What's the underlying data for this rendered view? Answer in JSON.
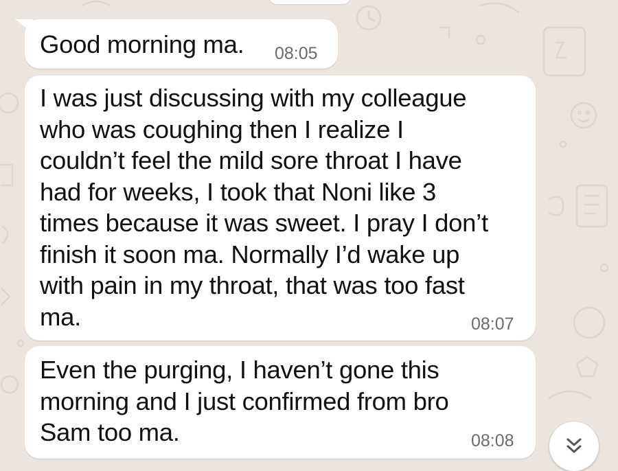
{
  "conversation": {
    "messages": [
      {
        "text": "Good morning ma.",
        "time": "08:05"
      },
      {
        "text": "I was just discussing with my colleague\nwho was coughing then I realize I\ncouldn’t feel the mild sore throat I have\nhad for weeks, I took that Noni like 3\ntimes because it was sweet. I pray I don’t\nfinish it soon ma. Normally I’d wake up\nwith pain in my throat, that was too fast\nma.",
        "time": "08:07"
      },
      {
        "text": "Even the purging, I haven’t gone this\nmorning and I just confirmed from bro\nSam too ma.",
        "time": "08:08"
      }
    ]
  },
  "scroll_button": {
    "icon": "double-chevron-down-icon"
  },
  "colors": {
    "wallpaper": "#ece5dd",
    "bubble": "#ffffff",
    "text": "#111111",
    "timestamp": "#6b6b6b",
    "doodle": "#e2d9cd"
  }
}
